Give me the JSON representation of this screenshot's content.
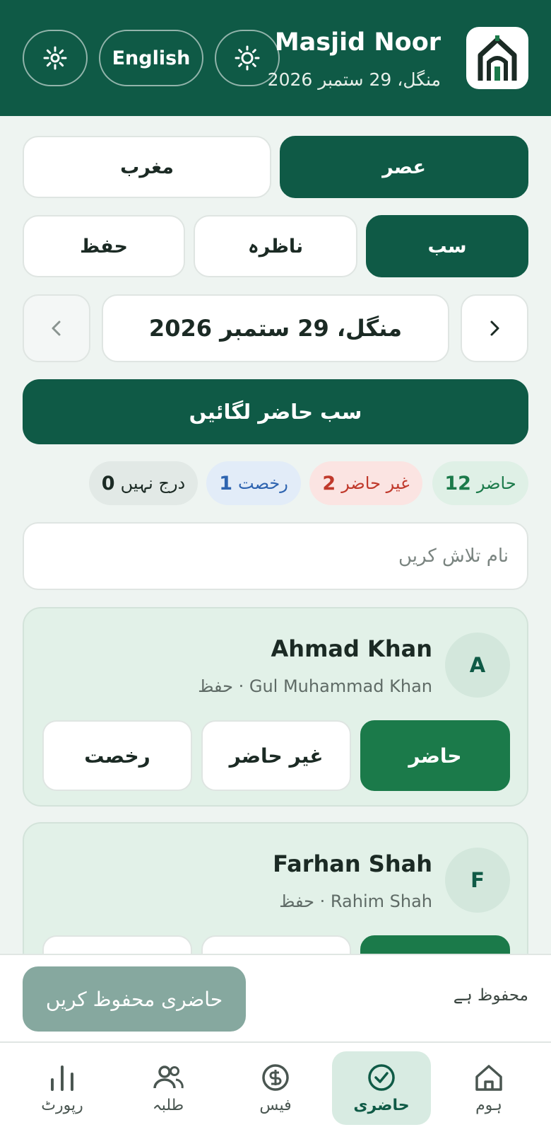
{
  "header": {
    "title": "Masjid Noor",
    "date": "منگل، 29 ستمبر 2026",
    "language_button": "English"
  },
  "prayers": [
    {
      "label": "عصر",
      "active": true
    },
    {
      "label": "مغرب",
      "active": false
    }
  ],
  "filters": [
    {
      "label": "سب",
      "active": true
    },
    {
      "label": "ناظرہ",
      "active": false
    },
    {
      "label": "حفظ",
      "active": false
    }
  ],
  "date_nav": {
    "date": "منگل، 29 ستمبر 2026"
  },
  "mark_all_label": "سب حاضر لگائیں",
  "summary": {
    "present": {
      "label": "حاضر",
      "count": "12"
    },
    "absent": {
      "label": "غیر حاضر",
      "count": "2"
    },
    "leave": {
      "label": "رخصت",
      "count": "1"
    },
    "unmarked": {
      "label": "درج نہیں",
      "count": "0"
    }
  },
  "search": {
    "placeholder": "نام تلاش کریں"
  },
  "students": [
    {
      "initial": "A",
      "name": "Ahmad Khan",
      "subtitle": "Gul Muhammad Khan · حفظ",
      "status": "present"
    },
    {
      "initial": "F",
      "name": "Farhan Shah",
      "subtitle": "Rahim Shah · حفظ",
      "status": "present"
    }
  ],
  "status_buttons": {
    "present": "حاضر",
    "absent": "غیر حاضر",
    "leave": "رخصت"
  },
  "save_bar": {
    "button": "حاضری محفوظ کریں",
    "status": "محفوظ ہے"
  },
  "tabs": [
    {
      "label": "ہوم",
      "icon": "home-icon",
      "active": false
    },
    {
      "label": "حاضری",
      "icon": "check-circle-icon",
      "active": true
    },
    {
      "label": "فیس",
      "icon": "coin-icon",
      "active": false
    },
    {
      "label": "طلبہ",
      "icon": "users-icon",
      "active": false
    },
    {
      "label": "رپورٹ",
      "icon": "bar-chart-icon",
      "active": false
    }
  ],
  "colors": {
    "primary": "#0f5a46",
    "present": "#1b7a4a",
    "absent": "#c0392b",
    "leave": "#2e64b0"
  }
}
